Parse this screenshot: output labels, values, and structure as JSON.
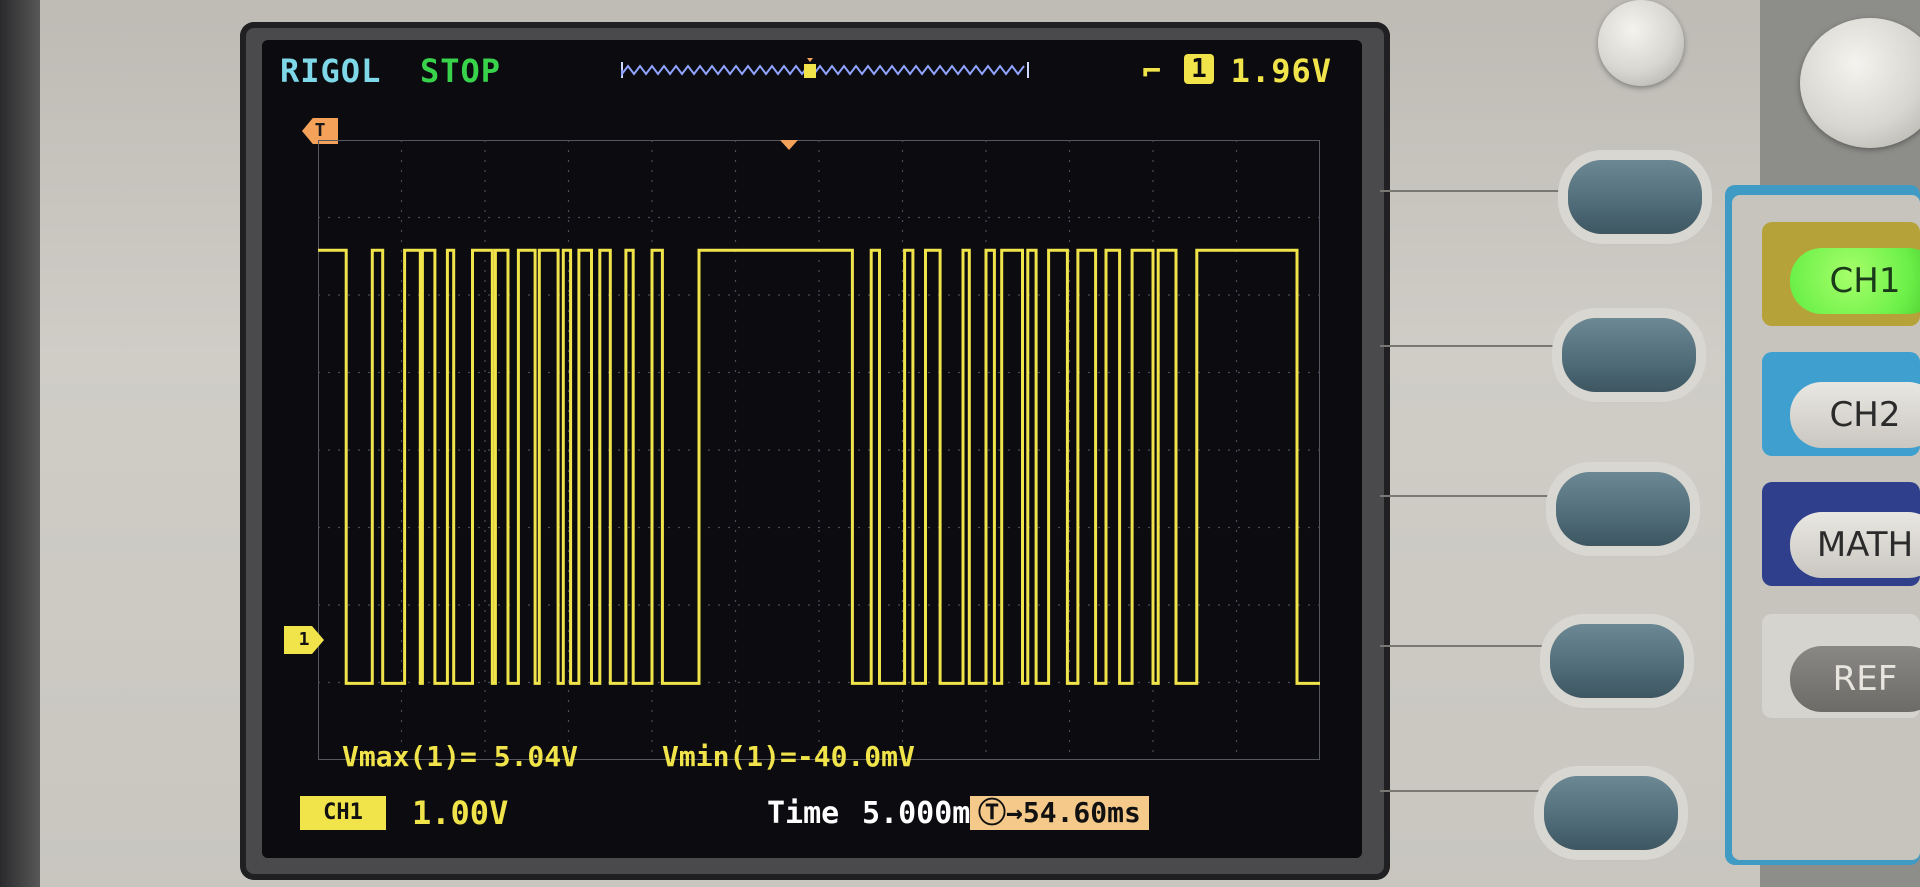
{
  "header": {
    "brand": "RIGOL",
    "run_state": "STOP",
    "trigger_source": "1",
    "trigger_edge_icon": "falling-edge-icon",
    "trigger_level": "1.96V"
  },
  "markers": {
    "trigger_marker": "T",
    "channel_ref_marker": "1"
  },
  "measurements": {
    "vmax": "Vmax(1)= 5.04V",
    "vmin": "Vmin(1)=-40.0mV"
  },
  "footer": {
    "channel_tag": "CH1",
    "channel_scale": "1.00V",
    "time_label": "Time",
    "time_base": "5.000ms",
    "trigger_delay": "Ⓣ→54.60ms"
  },
  "panel_buttons": {
    "ch1": "CH1",
    "ch2": "CH2",
    "math": "MATH",
    "ref": "REF"
  },
  "colors": {
    "trace": "#f1e44a",
    "brand": "#7fd8e8",
    "stop": "#39d24b",
    "ch1_button": "#6cf048",
    "panel_accent": "#3f9bc4"
  },
  "waveform": {
    "volts_per_div": 1.0,
    "high_level_v": 5.04,
    "low_level_v": -0.04,
    "pulses_high_segments_div": [
      [
        0.0,
        0.27
      ],
      [
        0.52,
        0.62
      ],
      [
        0.83,
        0.98
      ],
      [
        1.0,
        1.12
      ],
      [
        1.24,
        1.3
      ],
      [
        1.48,
        1.67
      ],
      [
        1.7,
        1.82
      ],
      [
        1.92,
        2.08
      ],
      [
        2.12,
        2.3
      ],
      [
        2.35,
        2.42
      ],
      [
        2.5,
        2.62
      ],
      [
        2.7,
        2.8
      ],
      [
        2.95,
        3.02
      ],
      [
        3.2,
        3.3
      ],
      [
        3.65,
        5.12
      ],
      [
        5.3,
        5.38
      ],
      [
        5.62,
        5.7
      ],
      [
        5.82,
        5.96
      ],
      [
        6.18,
        6.24
      ],
      [
        6.4,
        6.48
      ],
      [
        6.55,
        6.75
      ],
      [
        6.8,
        6.88
      ],
      [
        7.0,
        7.18
      ],
      [
        7.28,
        7.45
      ],
      [
        7.55,
        7.68
      ],
      [
        7.8,
        8.0
      ],
      [
        8.05,
        8.22
      ],
      [
        8.42,
        9.38
      ],
      [
        9.62,
        9.7
      ]
    ]
  }
}
